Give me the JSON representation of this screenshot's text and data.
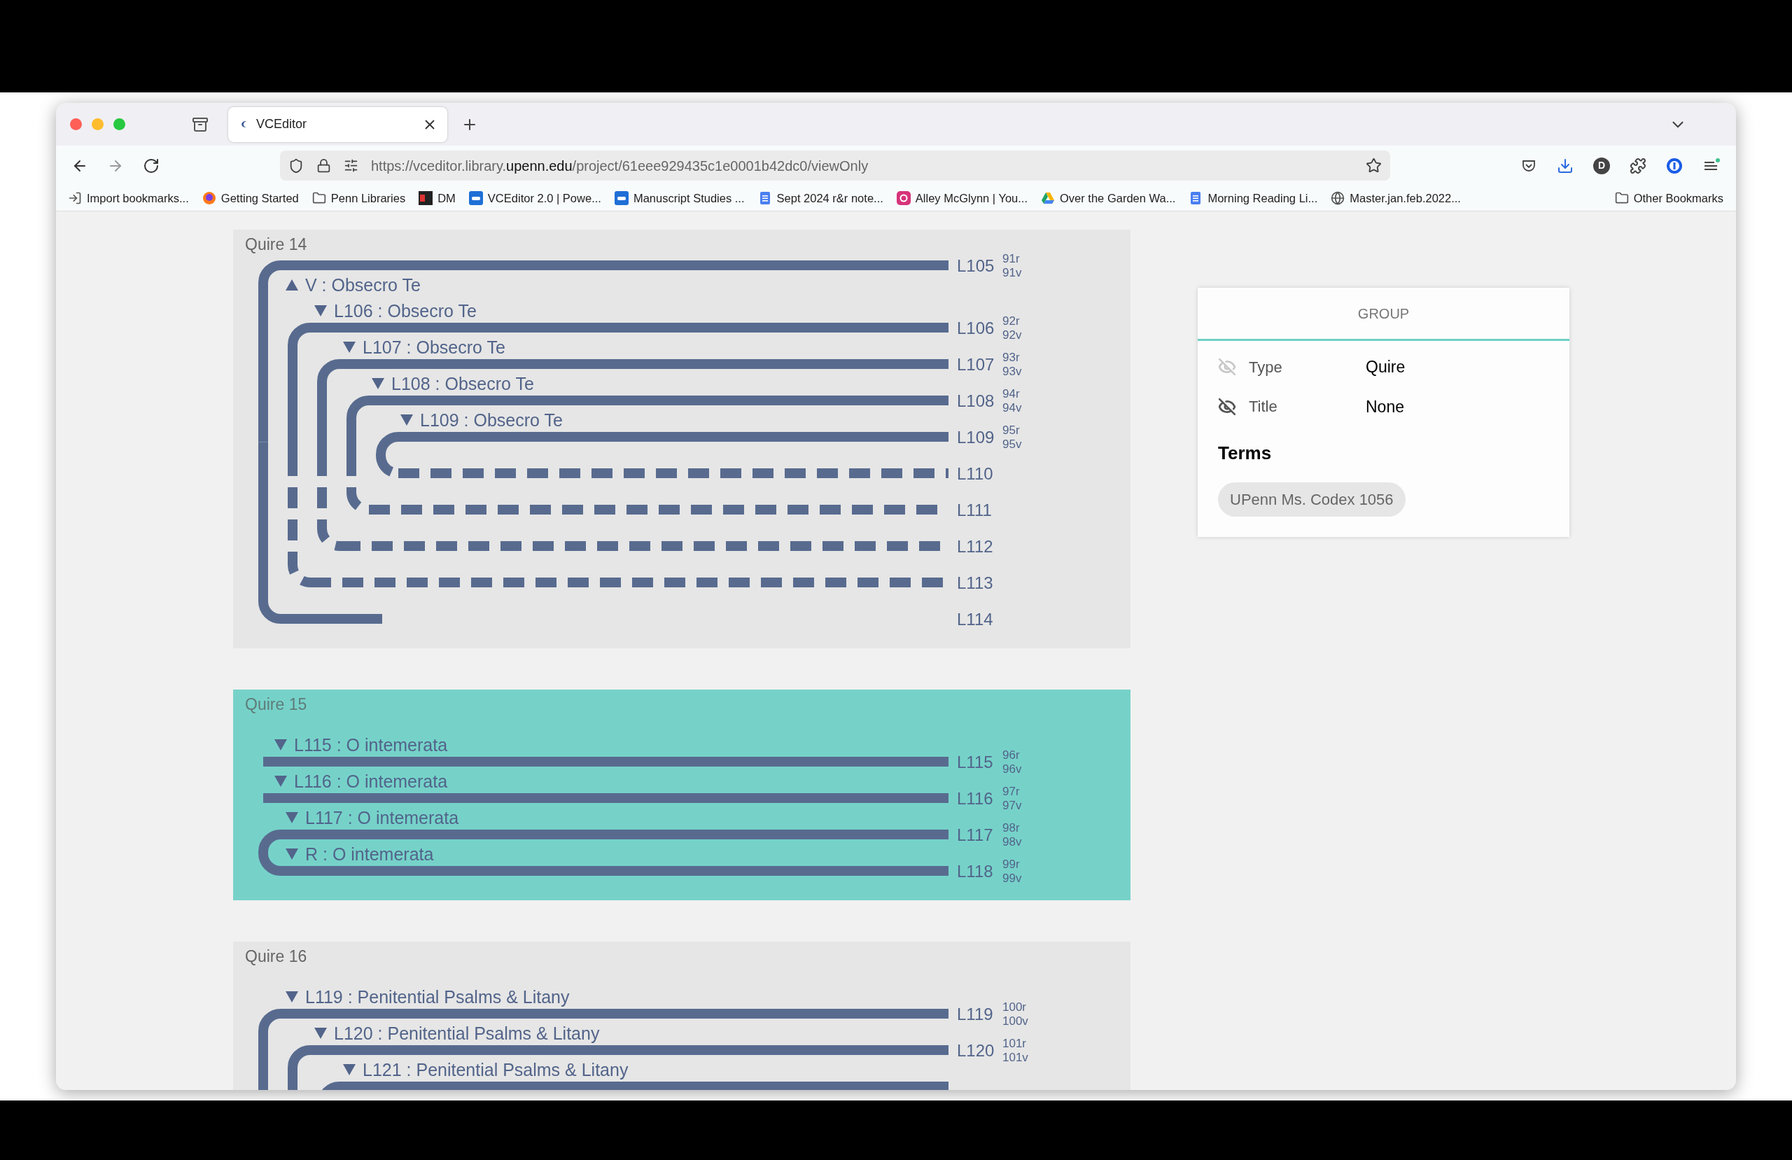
{
  "browser": {
    "tab": {
      "title": "VCEditor"
    },
    "url": {
      "prefix": "https://vceditor.library.",
      "domain": "upenn.edu",
      "path": "/project/61eee929435c1e0001b42dc0/viewOnly"
    },
    "account_initial": "D",
    "bookmarks": [
      {
        "kind": "import",
        "label": "Import bookmarks..."
      },
      {
        "kind": "browser",
        "label": "Getting Started"
      },
      {
        "kind": "folder",
        "label": "Penn Libraries"
      },
      {
        "kind": "dark-square",
        "label": "DM"
      },
      {
        "kind": "blue-square",
        "label": "VCEditor 2.0 | Powe..."
      },
      {
        "kind": "blue-square",
        "label": "Manuscript Studies ..."
      },
      {
        "kind": "document",
        "label": "Sept 2024 r&r note..."
      },
      {
        "kind": "camera",
        "label": "Alley McGlynn | You..."
      },
      {
        "kind": "triangle",
        "label": "Over the Garden Wa..."
      },
      {
        "kind": "document",
        "label": "Morning Reading Li..."
      },
      {
        "kind": "globe",
        "label": "Master.jan.feb.2022..."
      }
    ],
    "other_bookmarks": "Other Bookmarks"
  },
  "quires": [
    {
      "title": "Quire 14",
      "selected": false,
      "truncated": false,
      "leaves": [
        {
          "label": "L105",
          "folios": [
            "91r",
            "91v"
          ],
          "kind": "leaf"
        },
        {
          "label": "L106",
          "folios": [
            "92r",
            "92v"
          ],
          "kind": "leaf",
          "headings": [
            {
              "text": "V : Obsecro Te",
              "expanded": false
            },
            {
              "text": "L106 : Obsecro Te",
              "expanded": true
            }
          ]
        },
        {
          "label": "L107",
          "folios": [
            "93r",
            "93v"
          ],
          "kind": "leaf",
          "headings": [
            {
              "text": "L107 : Obsecro Te",
              "expanded": true
            }
          ]
        },
        {
          "label": "L108",
          "folios": [
            "94r",
            "94v"
          ],
          "kind": "leaf",
          "headings": [
            {
              "text": "L108 : Obsecro Te",
              "expanded": true
            }
          ]
        },
        {
          "label": "L109",
          "folios": [
            "95r",
            "95v"
          ],
          "kind": "leaf",
          "headings": [
            {
              "text": "L109 : Obsecro Te",
              "expanded": true
            }
          ]
        },
        {
          "label": "L110",
          "kind": "missing"
        },
        {
          "label": "L111",
          "kind": "missing"
        },
        {
          "label": "L112",
          "kind": "missing"
        },
        {
          "label": "L113",
          "kind": "missing"
        },
        {
          "label": "L114",
          "kind": "stub"
        }
      ]
    },
    {
      "title": "Quire 15",
      "selected": true,
      "truncated": false,
      "leaves": [
        {
          "label": "L115",
          "folios": [
            "96r",
            "96v"
          ],
          "kind": "single",
          "headings": [
            {
              "text": "L115 : O intemerata",
              "expanded": true
            }
          ]
        },
        {
          "label": "L116",
          "folios": [
            "97r",
            "97v"
          ],
          "kind": "single",
          "headings": [
            {
              "text": "L116 : O intemerata",
              "expanded": true
            }
          ]
        },
        {
          "label": "L117",
          "folios": [
            "98r",
            "98v"
          ],
          "kind": "leaf",
          "headings": [
            {
              "text": "L117 : O intemerata",
              "expanded": true
            }
          ]
        },
        {
          "label": "L118",
          "folios": [
            "99r",
            "99v"
          ],
          "kind": "leaf",
          "headings": [
            {
              "text": "R : O intemerata",
              "expanded": true
            }
          ]
        }
      ]
    },
    {
      "title": "Quire 16",
      "selected": false,
      "truncated": true,
      "leaves": [
        {
          "label": "L119",
          "folios": [
            "100r",
            "100v"
          ],
          "kind": "leaf",
          "headings": [
            {
              "text": "L119 : Penitential Psalms & Litany",
              "expanded": true
            }
          ]
        },
        {
          "label": "L120",
          "folios": [
            "101r",
            "101v"
          ],
          "kind": "leaf",
          "headings": [
            {
              "text": "L120 : Penitential Psalms & Litany",
              "expanded": true
            }
          ]
        },
        {
          "kind": "leaf",
          "headings": [
            {
              "text": "L121 : Penitential Psalms & Litany",
              "expanded": true
            }
          ]
        }
      ]
    }
  ],
  "group_panel": {
    "title": "GROUP",
    "fields": [
      {
        "label": "Type",
        "value": "Quire",
        "disabled": true
      },
      {
        "label": "Title",
        "value": "None",
        "disabled": false
      }
    ],
    "terms_heading": "Terms",
    "terms": [
      "UPenn Ms. Codex 1056"
    ]
  }
}
